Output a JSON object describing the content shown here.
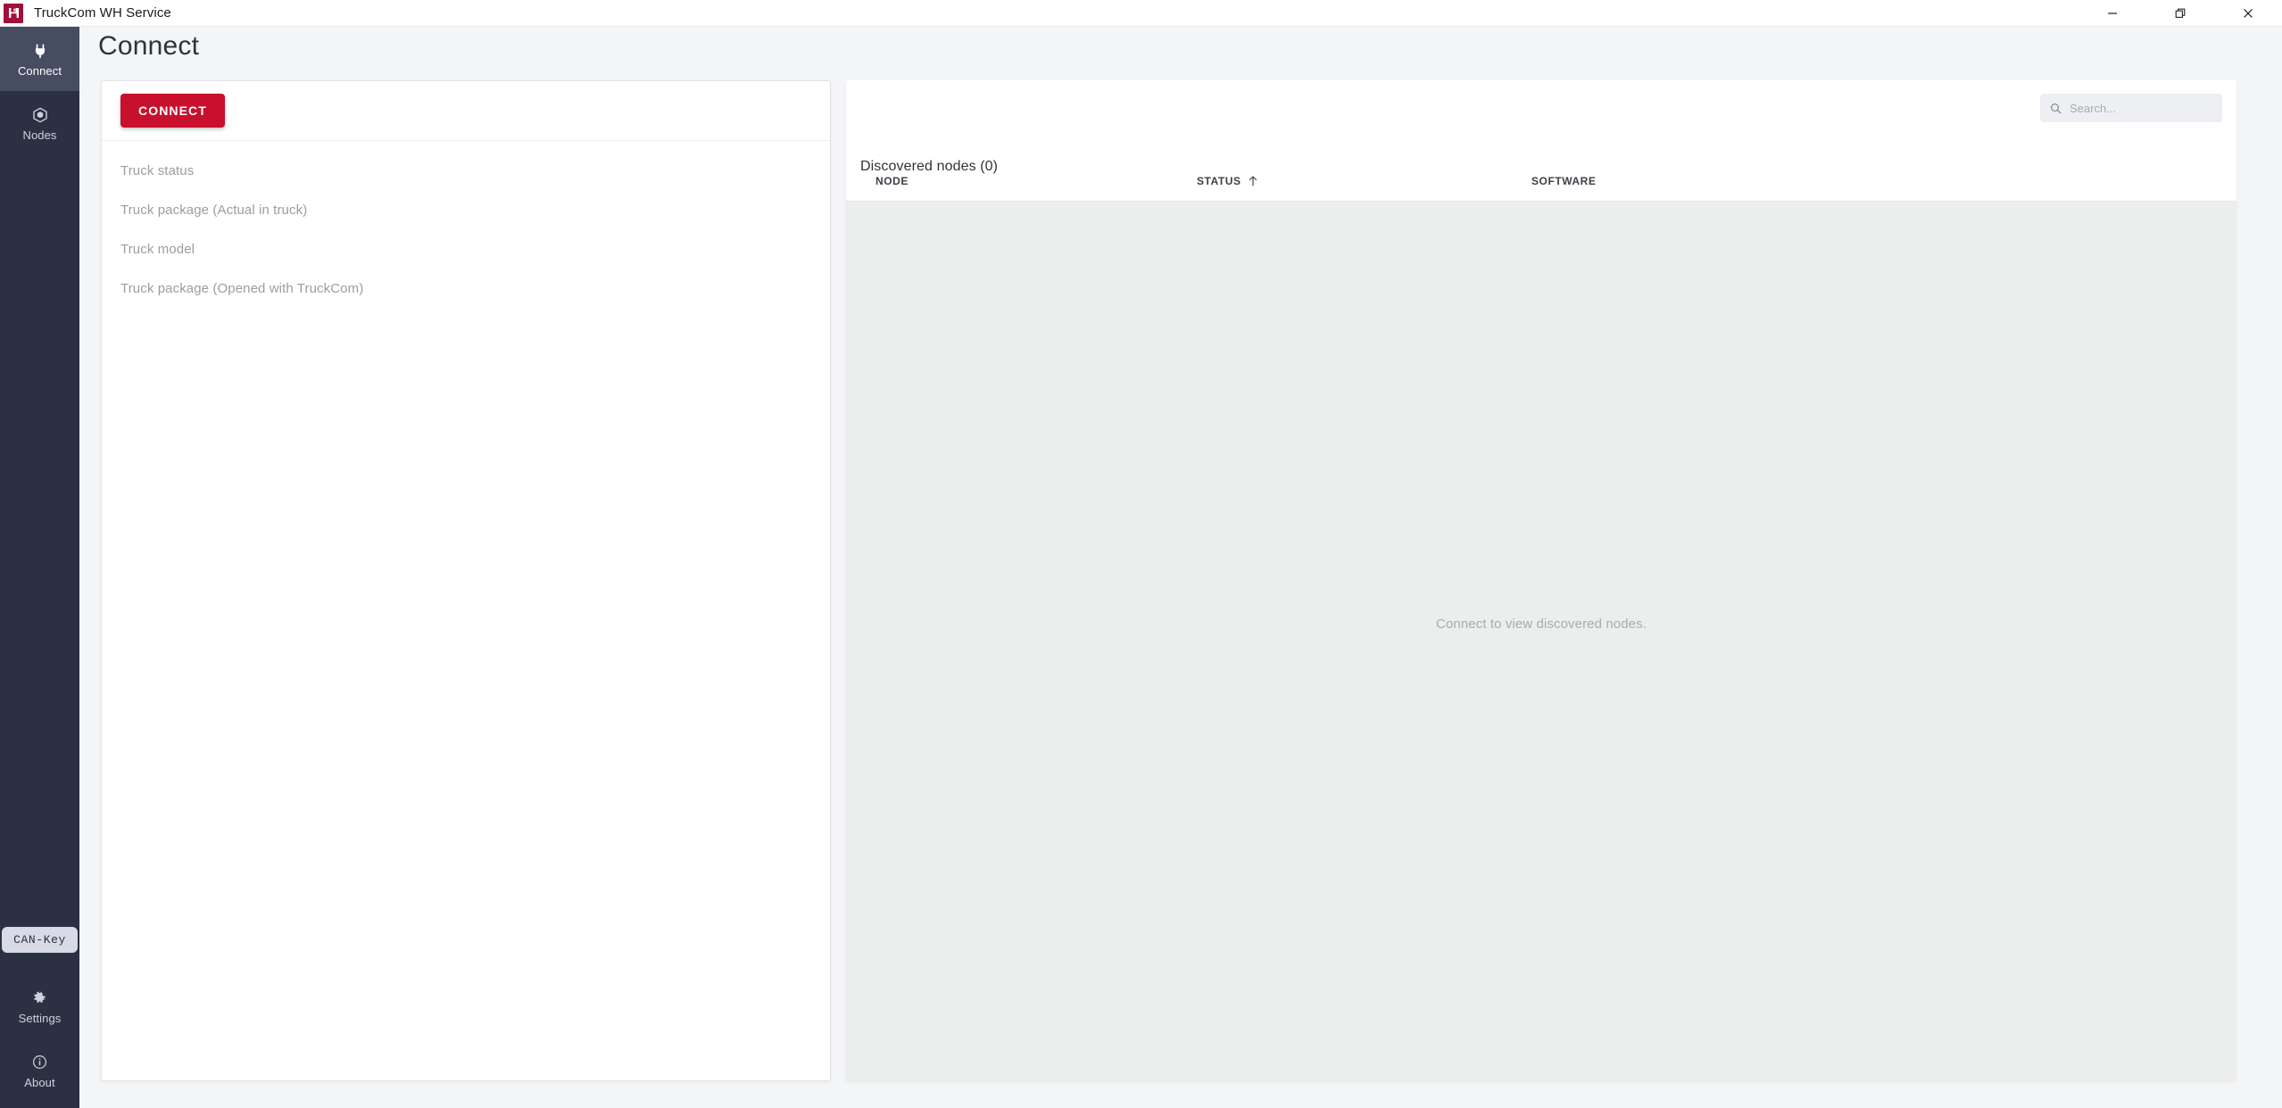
{
  "window": {
    "title": "TruckCom WH Service",
    "app_icon": "floppy-disk-icon",
    "controls": [
      {
        "name": "minimize",
        "glyph": "minimize-icon"
      },
      {
        "name": "restore",
        "glyph": "restore-icon"
      },
      {
        "name": "close",
        "glyph": "close-icon"
      }
    ]
  },
  "sidebar": {
    "background": "#2b3143",
    "selected_background": "#474d61",
    "items": [
      {
        "label": "Connect",
        "icon": "power-plug-icon",
        "selected": true
      },
      {
        "label": "Nodes",
        "icon": "node-cube-icon",
        "selected": false
      }
    ],
    "badge": {
      "label": "CAN-Key",
      "background": "#d8dae6",
      "color": "#2b3143"
    },
    "bottom_items": [
      {
        "label": "Settings",
        "icon": "gear-icon"
      },
      {
        "label": "About",
        "icon": "info-circle-icon"
      }
    ]
  },
  "page": {
    "title": "Connect"
  },
  "left_panel": {
    "connect_button": {
      "label": "CONNECT",
      "color": "#c8102e"
    },
    "options": [
      {
        "label": "Truck status"
      },
      {
        "label": "Truck package (Actual in truck)"
      },
      {
        "label": "Truck model"
      },
      {
        "label": "Truck package (Opened with TruckCom)"
      }
    ]
  },
  "right_panel": {
    "title": "Discovered nodes (0)",
    "node_count": 0,
    "search": {
      "placeholder": "Search...",
      "value": "",
      "icon": "search-icon"
    },
    "table": {
      "columns": [
        {
          "key": "node",
          "label": "NODE",
          "sorted": false
        },
        {
          "key": "status",
          "label": "STATUS",
          "sorted": true,
          "sort_direction": "asc",
          "sort_icon": "arrow-up-icon"
        },
        {
          "key": "software",
          "label": "SOFTWARE",
          "sorted": false
        }
      ],
      "rows": []
    },
    "empty_message": "Connect to view discovered nodes."
  }
}
